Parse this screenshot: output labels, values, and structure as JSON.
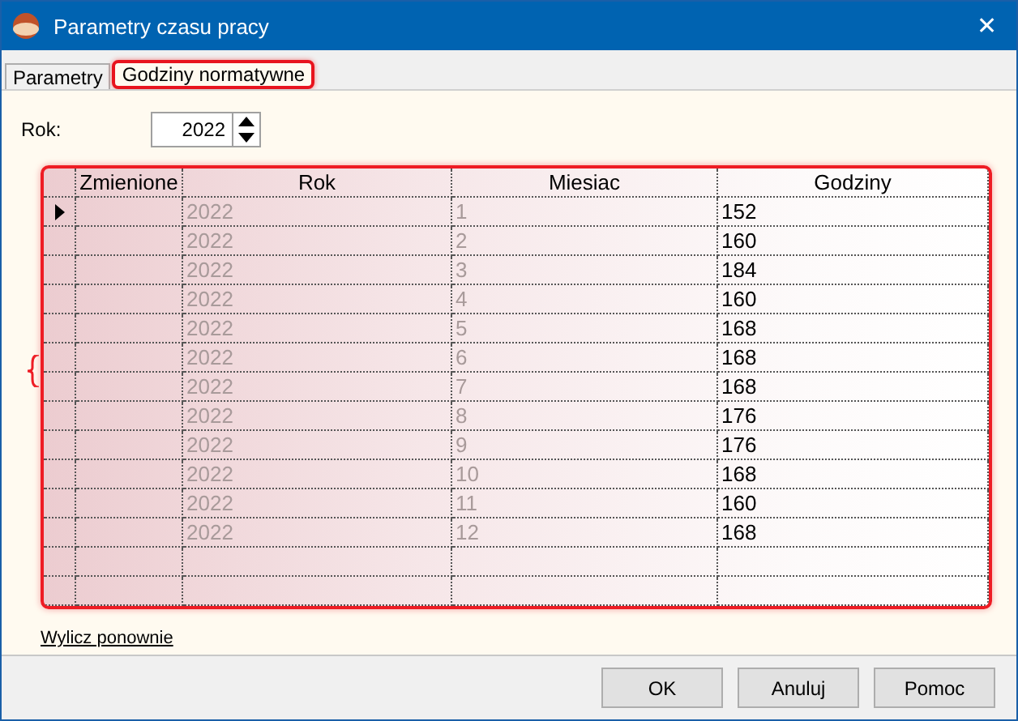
{
  "window": {
    "title": "Parametry czasu pracy",
    "close": "✕"
  },
  "tabs": [
    {
      "label": "Parametry",
      "selected": false,
      "highlighted": false
    },
    {
      "label": "Godziny normatywne",
      "selected": true,
      "highlighted": true
    }
  ],
  "year_field": {
    "label": "Rok:",
    "value": "2022"
  },
  "grid": {
    "highlighted": true,
    "columns": [
      "Zmienione",
      "Rok",
      "Miesiac",
      "Godziny"
    ],
    "rows": [
      {
        "kind": "data",
        "current": true,
        "year": "2022",
        "month": "1",
        "hours": "152"
      },
      {
        "kind": "data",
        "current": false,
        "year": "2022",
        "month": "2",
        "hours": "160"
      },
      {
        "kind": "data",
        "current": false,
        "year": "2022",
        "month": "3",
        "hours": "184"
      },
      {
        "kind": "data",
        "current": false,
        "year": "2022",
        "month": "4",
        "hours": "160"
      },
      {
        "kind": "data",
        "current": false,
        "year": "2022",
        "month": "5",
        "hours": "168"
      },
      {
        "kind": "data",
        "current": false,
        "year": "2022",
        "month": "6",
        "hours": "168"
      },
      {
        "kind": "data",
        "current": false,
        "year": "2022",
        "month": "7",
        "hours": "168"
      },
      {
        "kind": "data",
        "current": false,
        "year": "2022",
        "month": "8",
        "hours": "176"
      },
      {
        "kind": "data",
        "current": false,
        "year": "2022",
        "month": "9",
        "hours": "176"
      },
      {
        "kind": "data",
        "current": false,
        "year": "2022",
        "month": "10",
        "hours": "168"
      },
      {
        "kind": "data",
        "current": false,
        "year": "2022",
        "month": "11",
        "hours": "160"
      },
      {
        "kind": "data",
        "current": false,
        "year": "2022",
        "month": "12",
        "hours": "168"
      },
      {
        "kind": "blank"
      },
      {
        "kind": "blank"
      }
    ]
  },
  "link": "Wylicz ponownie",
  "buttons": [
    "OK",
    "Anuluj",
    "Pomoc"
  ]
}
